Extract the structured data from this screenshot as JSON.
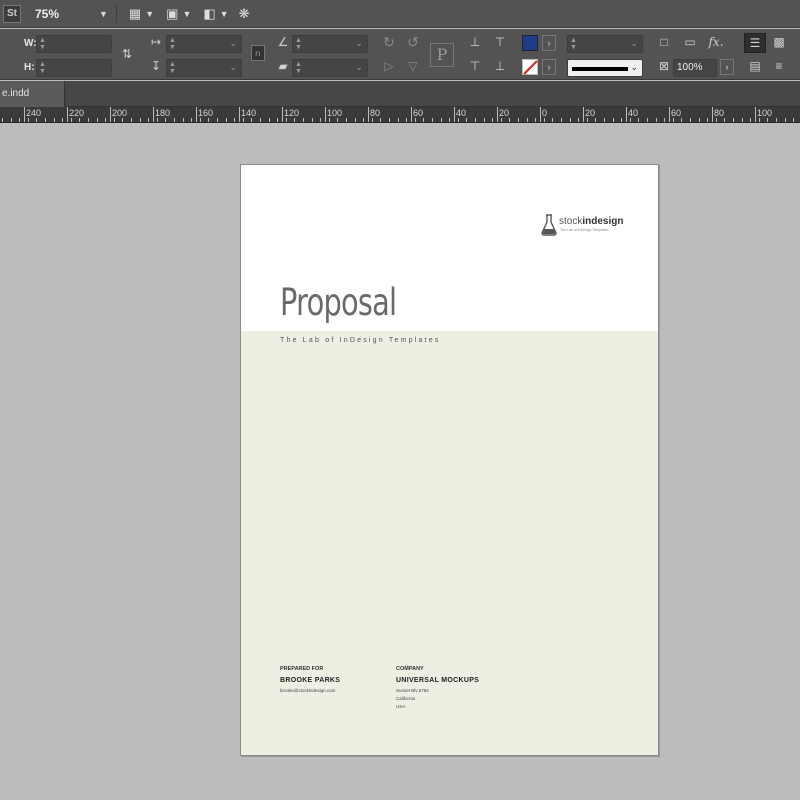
{
  "app": {
    "badge": "St",
    "zoom": "75%",
    "document_tab": "e.indd"
  },
  "control": {
    "w_label": "W:",
    "h_label": "H:",
    "opacity": "100%",
    "fx_label": "fx.",
    "p_label": "P",
    "fill_color": "#1f3b8c",
    "stroke_color": "#ffffff"
  },
  "ruler": {
    "ticks": [
      "240",
      "220",
      "200",
      "180",
      "160",
      "140",
      "120",
      "100",
      "80",
      "60",
      "40",
      "20",
      "0",
      "20",
      "40",
      "60",
      "80",
      "100"
    ]
  },
  "page": {
    "title": "Proposal",
    "tagline": "The Lab of InDesign Templates",
    "logo_prefix": "stock",
    "logo_bold": "indesign",
    "logo_sub": "The Lab of InDesign Templates",
    "band_color": "#edefe3",
    "prepared_for_label": "PREPARED FOR",
    "prepared_for_name": "BROOKE PARKS",
    "prepared_for_email": "brooke@stockindesign.com",
    "company_label": "COMPANY",
    "company_name": "UNIVERSAL MOCKUPS",
    "company_address1": "Sunset Blv 6784",
    "company_address2": "California",
    "company_address3": "USA"
  }
}
